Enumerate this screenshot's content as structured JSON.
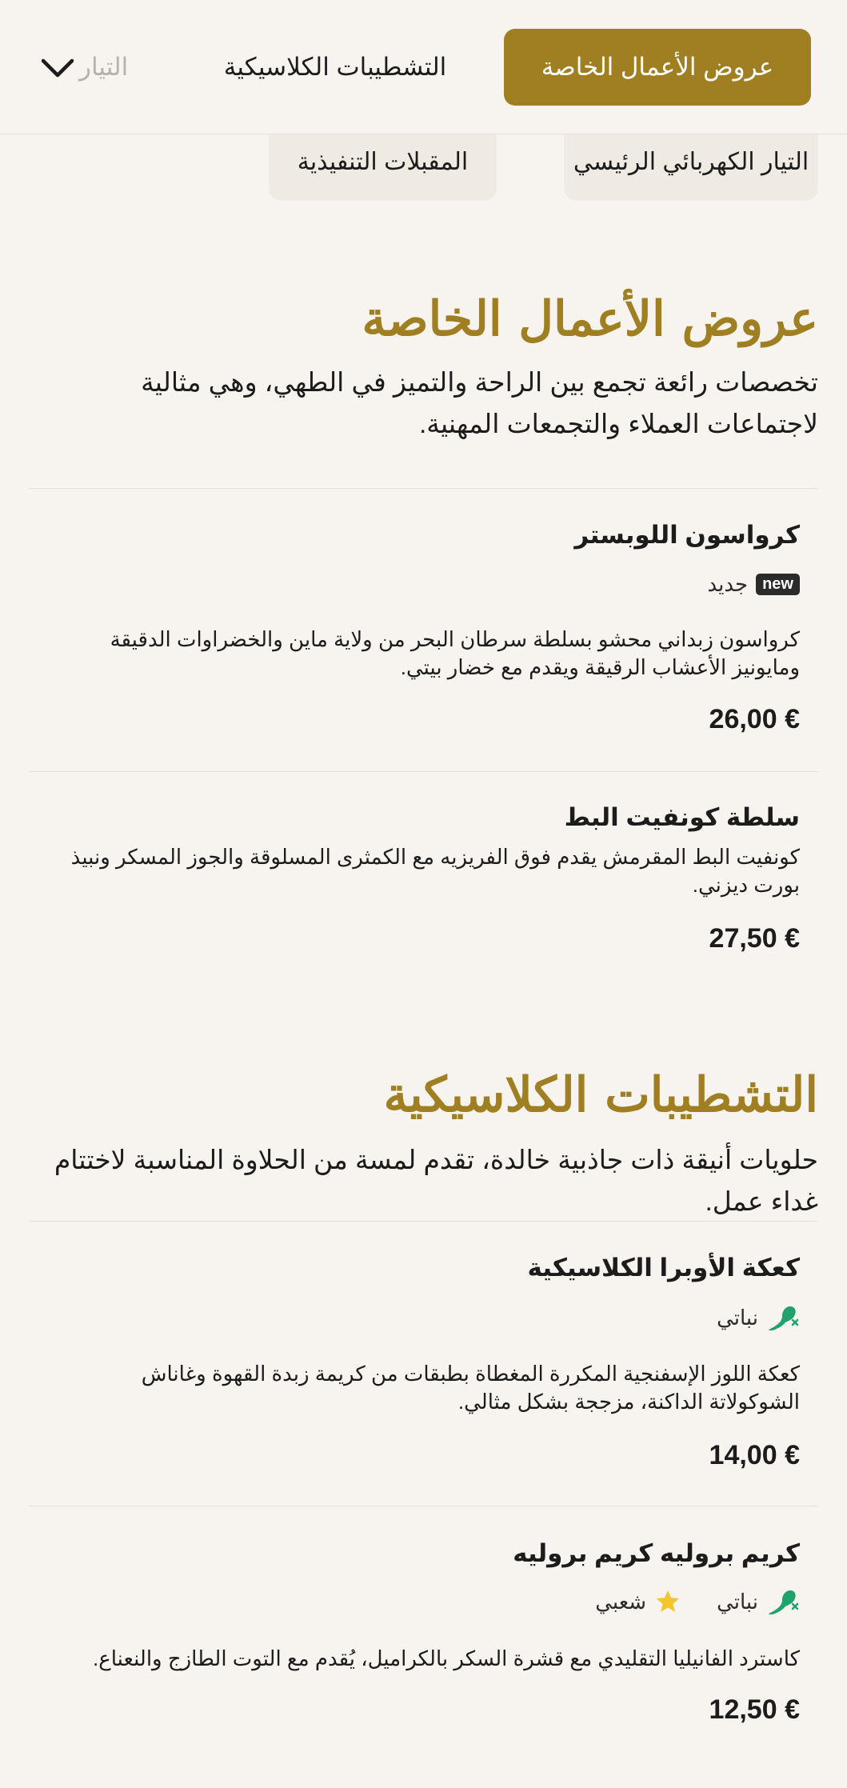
{
  "nav": {
    "tabs": [
      "عروض الأعمال الخاصة",
      "التشطيبات الكلاسيكية",
      "التيار"
    ]
  },
  "subcategories": [
    "التيار الكهربائي الرئيسي",
    "المقبلات التنفيذية"
  ],
  "sections": [
    {
      "title": "عروض الأعمال الخاصة",
      "description": "تخصصات رائعة تجمع بين الراحة والتميز في الطهي، وهي مثالية لاجتماعات العملاء والتجمعات المهنية.",
      "items": [
        {
          "name": "كرواسون اللوبستر",
          "tags": [
            {
              "badge": "new",
              "label": "جديد"
            }
          ],
          "description": "كرواسون زبداني محشو بسلطة سرطان البحر من ولاية ماين والخضراوات الدقيقة ومايونيز الأعشاب الرقيقة ويقدم مع خضار بيتي.",
          "price": "26,00 €"
        },
        {
          "name": "سلطة كونفيت البط",
          "description": "كونفيت البط المقرمش يقدم فوق الفريزيه مع الكمثرى المسلوقة والجوز المسكر ونبيذ بورت ديزني.",
          "price": "27,50 €"
        }
      ]
    },
    {
      "title": "التشطيبات الكلاسيكية",
      "description": "حلويات أنيقة ذات جاذبية خالدة، تقدم لمسة من الحلاوة المناسبة لاختتام غداء عمل.",
      "items": [
        {
          "name": "كعكة الأوبرا الكلاسيكية",
          "tags": [
            {
              "icon": "vegetarian-icon",
              "label": "نباتي"
            }
          ],
          "description": "كعكة اللوز الإسفنجية المكررة المغطاة بطبقات من كريمة زبدة القهوة وغاناش الشوكولاتة الداكنة، مزججة بشكل مثالي.",
          "price": "14,00 €"
        },
        {
          "name": "كريم بروليه كريم بروليه",
          "tags": [
            {
              "icon": "vegetarian-icon",
              "label": "نباتي"
            },
            {
              "icon": "star-icon",
              "label": "شعبي"
            }
          ],
          "description": "كاسترد الفانيليا التقليدي مع قشرة السكر بالكراميل، يُقدم مع التوت الطازج والنعناع.",
          "price": "12,50 €"
        }
      ]
    }
  ],
  "colors": {
    "accent": "#a07f22",
    "background": "#f7f4ef",
    "chip": "#efebe2",
    "vegetarian": "#1fa36b",
    "star": "#f2c531"
  }
}
